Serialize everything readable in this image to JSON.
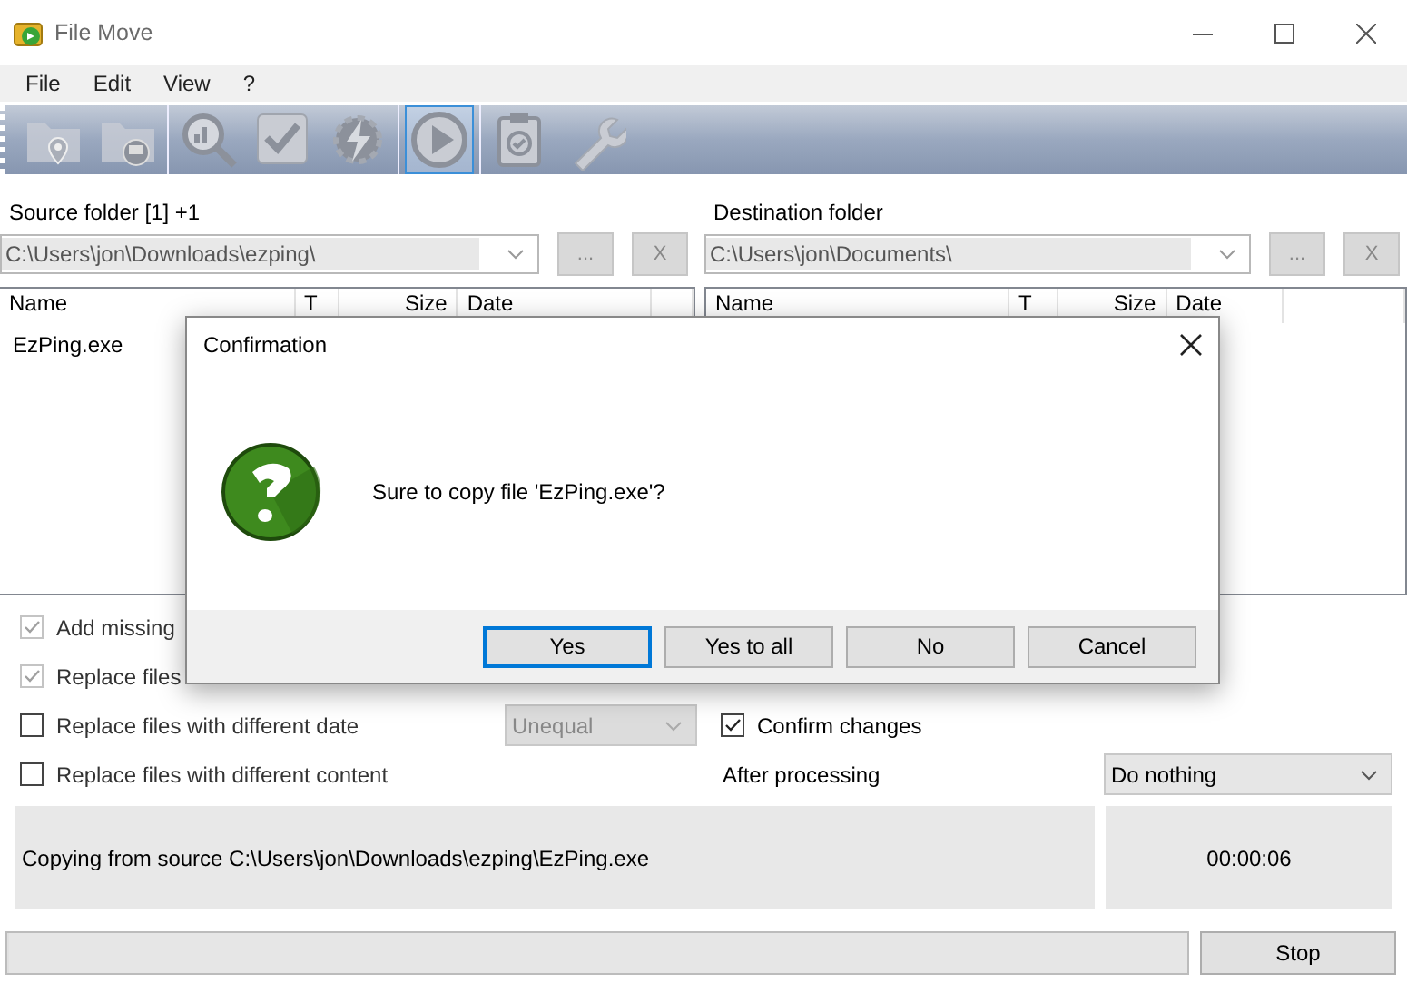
{
  "window": {
    "title": "File Move"
  },
  "menu": [
    {
      "label": "File"
    },
    {
      "label": "Edit"
    },
    {
      "label": "View"
    },
    {
      "label": "?"
    }
  ],
  "toolbar": {
    "groups": [
      {
        "items": [
          {
            "kind": "folder-pin",
            "selected": false
          },
          {
            "kind": "folder-drive",
            "selected": false
          }
        ]
      },
      {
        "items": [
          {
            "kind": "search-chart",
            "selected": false
          },
          {
            "kind": "check",
            "selected": false
          },
          {
            "kind": "bolt-gear",
            "selected": false
          }
        ]
      },
      {
        "items": [
          {
            "kind": "play",
            "selected": true
          }
        ]
      },
      {
        "items": [
          {
            "kind": "clipboard",
            "selected": false
          },
          {
            "kind": "wrench",
            "selected": false
          }
        ]
      }
    ]
  },
  "source": {
    "label": "Source folder [1] +1",
    "path": "C:\\Users\\jon\\Downloads\\ezping\\",
    "browse": "...",
    "clear": "X",
    "columns": [
      "Name",
      "T",
      "Size",
      "Date"
    ],
    "rows": [
      {
        "name": "EzPing.exe"
      }
    ]
  },
  "destination": {
    "label": "Destination folder",
    "path": "C:\\Users\\jon\\Documents\\",
    "browse": "...",
    "clear": "X",
    "columns": [
      "Name",
      "T",
      "Size",
      "Date"
    ]
  },
  "options": [
    {
      "label": "Add missing",
      "checked": true,
      "disabled": true
    },
    {
      "label": "Replace files",
      "checked": true,
      "disabled": true
    },
    {
      "label": "Replace files with different date",
      "checked": false,
      "disabled": false
    },
    {
      "label": "Replace files with different content",
      "checked": false,
      "disabled": false
    }
  ],
  "date_compare": {
    "value": "Unequal",
    "disabled": true
  },
  "confirm_changes": {
    "label": "Confirm changes",
    "checked": true,
    "disabled": false
  },
  "after_processing": {
    "label": "After processing",
    "value": "Do nothing"
  },
  "status": {
    "message": "Copying from source C:\\Users\\jon\\Downloads\\ezping\\EzPing.exe",
    "elapsed": "00:00:06"
  },
  "progress": {
    "level": 0
  },
  "stop_button": "Stop",
  "dialog": {
    "title": "Confirmation",
    "message": "Sure to copy file 'EzPing.exe'?",
    "buttons": [
      {
        "label": "Yes",
        "selected": true
      },
      {
        "label": "Yes to all",
        "selected": false
      },
      {
        "label": "No",
        "selected": false
      },
      {
        "label": "Cancel",
        "selected": false
      }
    ]
  }
}
